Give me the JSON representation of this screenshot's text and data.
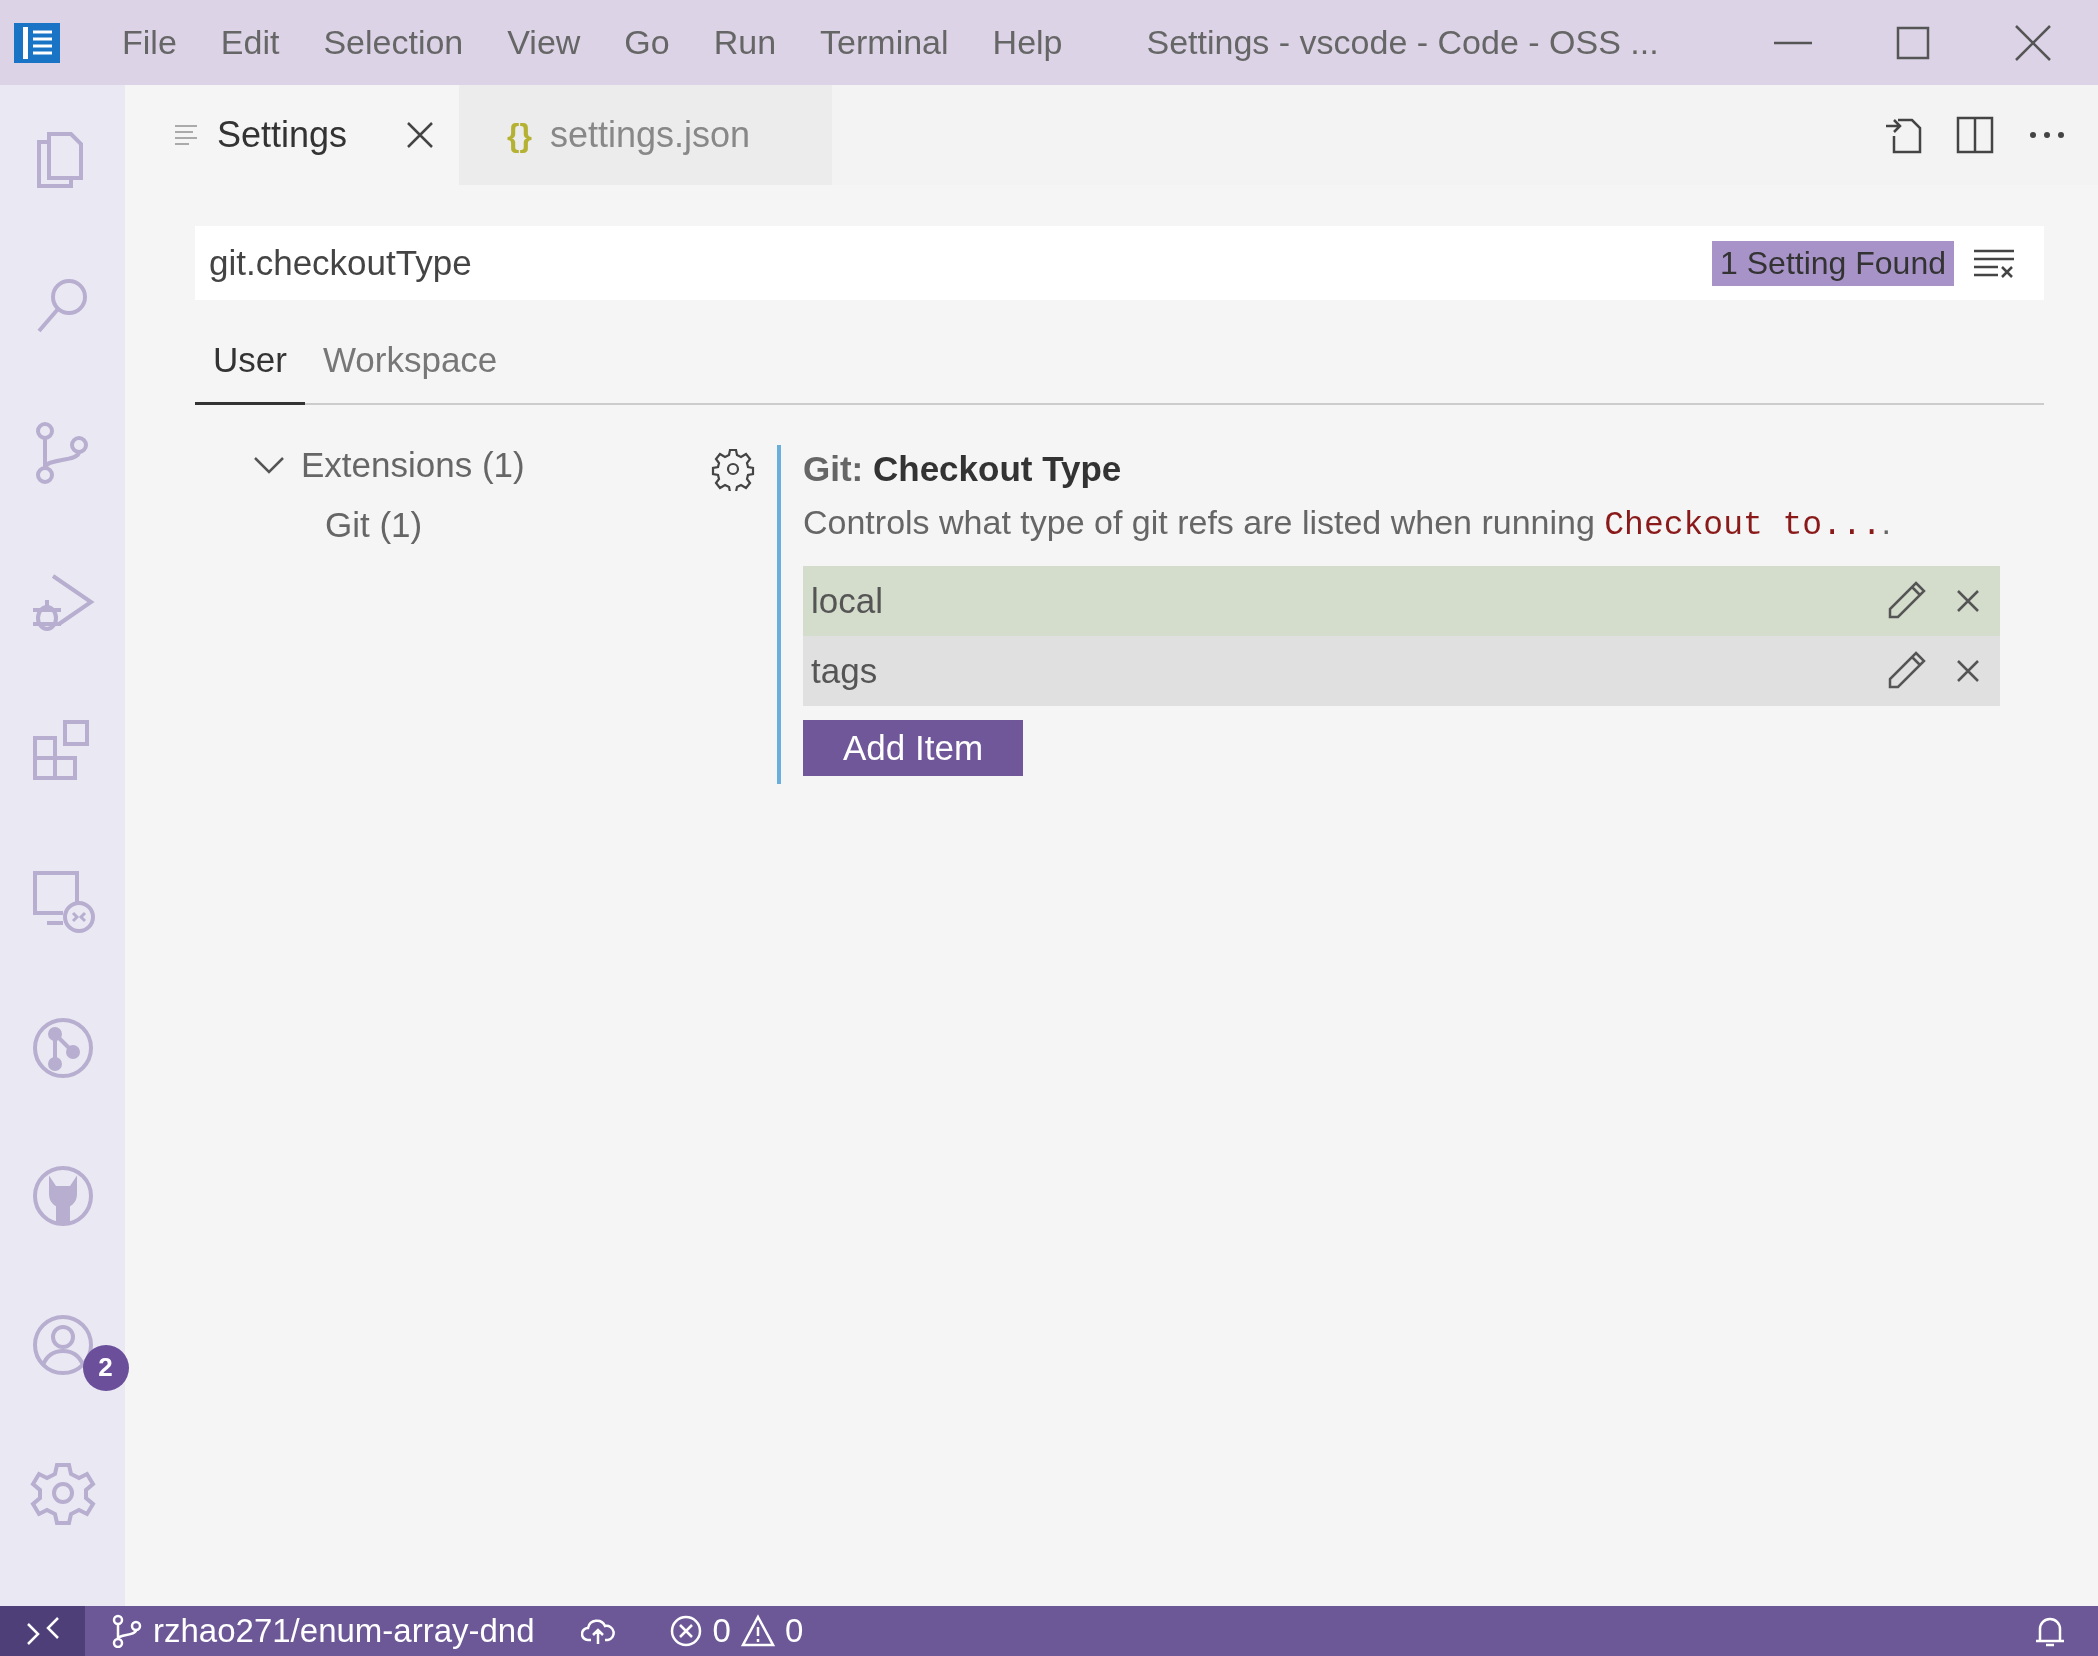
{
  "title_bar": {
    "menu": [
      "File",
      "Edit",
      "Selection",
      "View",
      "Go",
      "Run",
      "Terminal",
      "Help"
    ],
    "title": "Settings - vscode - Code - OSS ..."
  },
  "activity_bar": {
    "accounts_badge": "2"
  },
  "editor_tabs": [
    {
      "kind": "settings",
      "label": "Settings",
      "selected": true
    },
    {
      "kind": "json",
      "icon_text": "{}",
      "label": "settings.json",
      "selected": false
    }
  ],
  "search": {
    "value": "git.checkoutType",
    "result_count": "1 Setting Found"
  },
  "scope_tabs": [
    {
      "label": "User",
      "selected": true
    },
    {
      "label": "Workspace",
      "selected": false
    }
  ],
  "toc": [
    {
      "label": "Extensions (1)",
      "expanded": true,
      "children": [
        {
          "label": "Git (1)"
        }
      ]
    }
  ],
  "setting": {
    "category": "Git:",
    "title": "Checkout Type",
    "description": {
      "text": "Controls what type of git refs are listed when running ",
      "code": "Checkout to...",
      "end": "."
    },
    "items": [
      {
        "value": "local",
        "selected": true
      },
      {
        "value": "tags",
        "selected": false
      }
    ],
    "add_button": "Add Item"
  },
  "status_bar": {
    "branch": "rzhao271/enum-array-dnd",
    "errors": "0",
    "warnings": "0"
  }
}
